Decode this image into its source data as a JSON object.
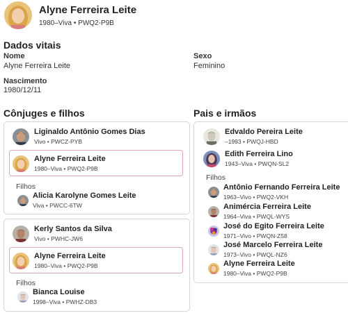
{
  "header": {
    "name": "Alyne Ferreira Leite",
    "years": "1980–Viva",
    "id": "PWQ2-P9B"
  },
  "vitals": {
    "title": "Dados vitais",
    "name_label": "Nome",
    "name_value": "Alyne Ferreira Leite",
    "sex_label": "Sexo",
    "sex_value": "Feminino",
    "birth_label": "Nascimento",
    "birth_value": "1980/12/11"
  },
  "spouses_section": {
    "title": "Cônjuges e filhos",
    "families": [
      {
        "spouse": {
          "name": "Liginaldo Antônio Gomes Dias",
          "years": "Vivo",
          "id": "PWCZ-PYB"
        },
        "self": {
          "name": "Alyne Ferreira Leite",
          "years": "1980–Viva",
          "id": "PWQ2-P9B"
        },
        "children_label": "Filhos",
        "children": [
          {
            "name": "Alicia Karolyne Gomes Leite",
            "years": "Viva",
            "id": "PWCC-6TW"
          }
        ]
      },
      {
        "spouse": {
          "name": "Kerly Santos da Silva",
          "years": "Vivo",
          "id": "PWHC-JW6"
        },
        "self": {
          "name": "Alyne Ferreira Leite",
          "years": "1980–Viva",
          "id": "PWQ2-P9B"
        },
        "children_label": "Filhos",
        "children": [
          {
            "name": "Bianca Louise",
            "years": "1998–Viva",
            "id": "PWHZ-DB3"
          }
        ]
      }
    ]
  },
  "parents_section": {
    "title": "Pais e irmãos",
    "parents": [
      {
        "name": "Edvaldo Pereira Leite",
        "years": "–1993",
        "id": "PWQJ-HBD"
      },
      {
        "name": "Edith Ferreira Lino",
        "years": "1943–Viva",
        "id": "PWQN-SL2"
      }
    ],
    "children_label": "Filhos",
    "children": [
      {
        "name": "Antônio Fernando Ferreira Leite",
        "years": "1963–Vivo",
        "id": "PWQ2-VKH"
      },
      {
        "name": "Animércia Ferreira Leite",
        "years": "1964–Viva",
        "id": "PWQL-WYS"
      },
      {
        "name": "José do Egito Ferreira Leite",
        "years": "1971–Vivo",
        "id": "PWQN-Z58"
      },
      {
        "name": "José Marcelo Ferreira Leite",
        "years": "1973–Vivo",
        "id": "PWQL-NZ6"
      },
      {
        "name": "Alyne Ferreira Leite",
        "years": "1980–Viva",
        "id": "PWQ2-P9B"
      }
    ]
  },
  "meta_separator": "•",
  "colors": {
    "selected_border": "#e3a6b4",
    "card_border": "#d6d6d6"
  }
}
